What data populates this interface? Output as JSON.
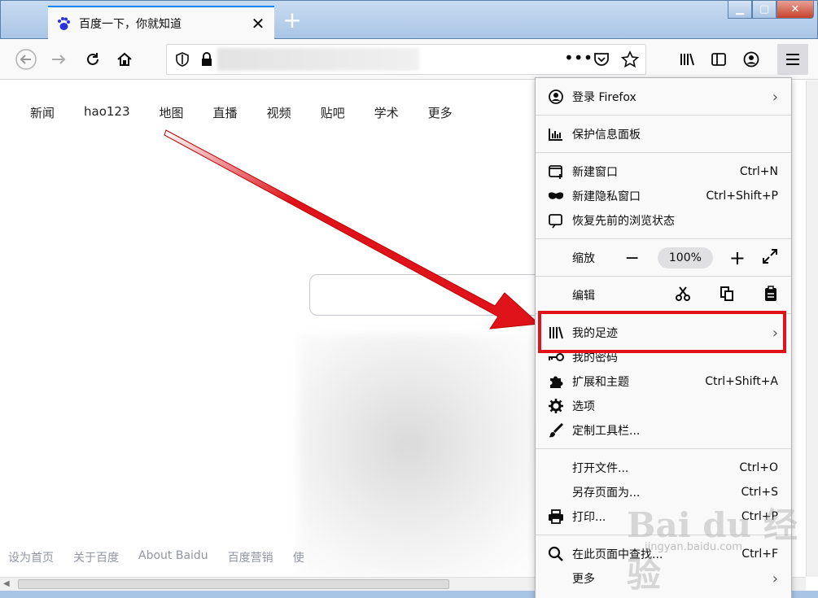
{
  "tab": {
    "title": "百度一下，你就知道",
    "close": "✕",
    "new_tab": "+"
  },
  "window": {
    "minimize": "▁",
    "maximize": "▢",
    "close": "✕"
  },
  "baidu": {
    "nav": [
      "新闻",
      "hao123",
      "地图",
      "直播",
      "视频",
      "贴吧",
      "学术",
      "更多"
    ],
    "footer": [
      "设为首页",
      "关于百度",
      "About Baidu",
      "百度营销",
      "使"
    ]
  },
  "menu": {
    "signin": "登录 Firefox",
    "protections": "保护信息面板",
    "new_window": {
      "label": "新建窗口",
      "shortcut": "Ctrl+N"
    },
    "new_private": {
      "label": "新建隐私窗口",
      "shortcut": "Ctrl+Shift+P"
    },
    "restore": "恢复先前的浏览状态",
    "zoom": {
      "label": "缩放",
      "value": "100%"
    },
    "edit": {
      "label": "编辑"
    },
    "library": "我的足迹",
    "logins": "我的密码",
    "addons": {
      "label": "扩展和主题",
      "shortcut": "Ctrl+Shift+A"
    },
    "options": "选项",
    "customize": "定制工具栏...",
    "open_file": {
      "label": "打开文件...",
      "shortcut": "Ctrl+O"
    },
    "save_page": {
      "label": "另存页面为...",
      "shortcut": "Ctrl+S"
    },
    "print": {
      "label": "打印...",
      "shortcut": "Ctrl+P"
    },
    "find": {
      "label": "在此页面中查找...",
      "shortcut": "Ctrl+F"
    },
    "more": "更多"
  },
  "watermark": {
    "text": "Bai du 经验",
    "sub": "jingyan.baidu.com"
  },
  "colors": {
    "highlight": "#e0131a",
    "arrow": "#e0131a",
    "accent": "#0a84ff"
  }
}
